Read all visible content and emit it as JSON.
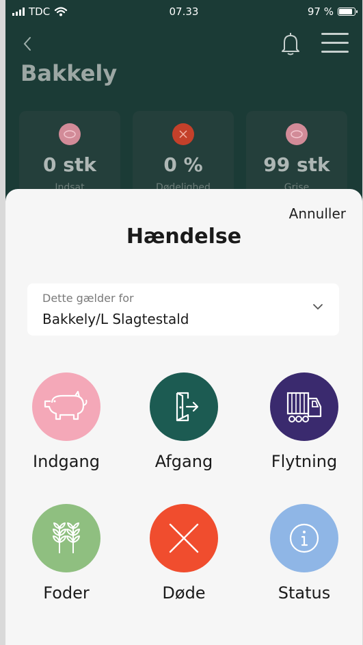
{
  "status_bar": {
    "carrier": "TDC",
    "time": "07.33",
    "battery": "97 %"
  },
  "header": {
    "title": "Bakkely"
  },
  "stats": [
    {
      "value": "0 stk",
      "label": "Indsat",
      "icon": "pig-icon",
      "color": "#d28b98"
    },
    {
      "value": "0 %",
      "label": "Dødelighed",
      "icon": "close-icon",
      "color": "#c4402a"
    },
    {
      "value": "99 stk",
      "label": "Grise",
      "icon": "pig-icon",
      "color": "#d28b98"
    }
  ],
  "sheet": {
    "cancel": "Annuller",
    "title": "Hændelse",
    "selector": {
      "label": "Dette gælder for",
      "value": "Bakkely/L Slagtestald"
    }
  },
  "actions": [
    {
      "label": "Indgang",
      "icon": "pig-icon",
      "color": "#f4a8b8"
    },
    {
      "label": "Afgang",
      "icon": "door-exit-icon",
      "color": "#1c5b52"
    },
    {
      "label": "Flytning",
      "icon": "truck-icon",
      "color": "#3a2a6e"
    },
    {
      "label": "Foder",
      "icon": "wheat-icon",
      "color": "#8fbf80"
    },
    {
      "label": "Døde",
      "icon": "close-icon",
      "color": "#f04d2e"
    },
    {
      "label": "Status",
      "icon": "info-icon",
      "color": "#8fb6e6"
    }
  ]
}
